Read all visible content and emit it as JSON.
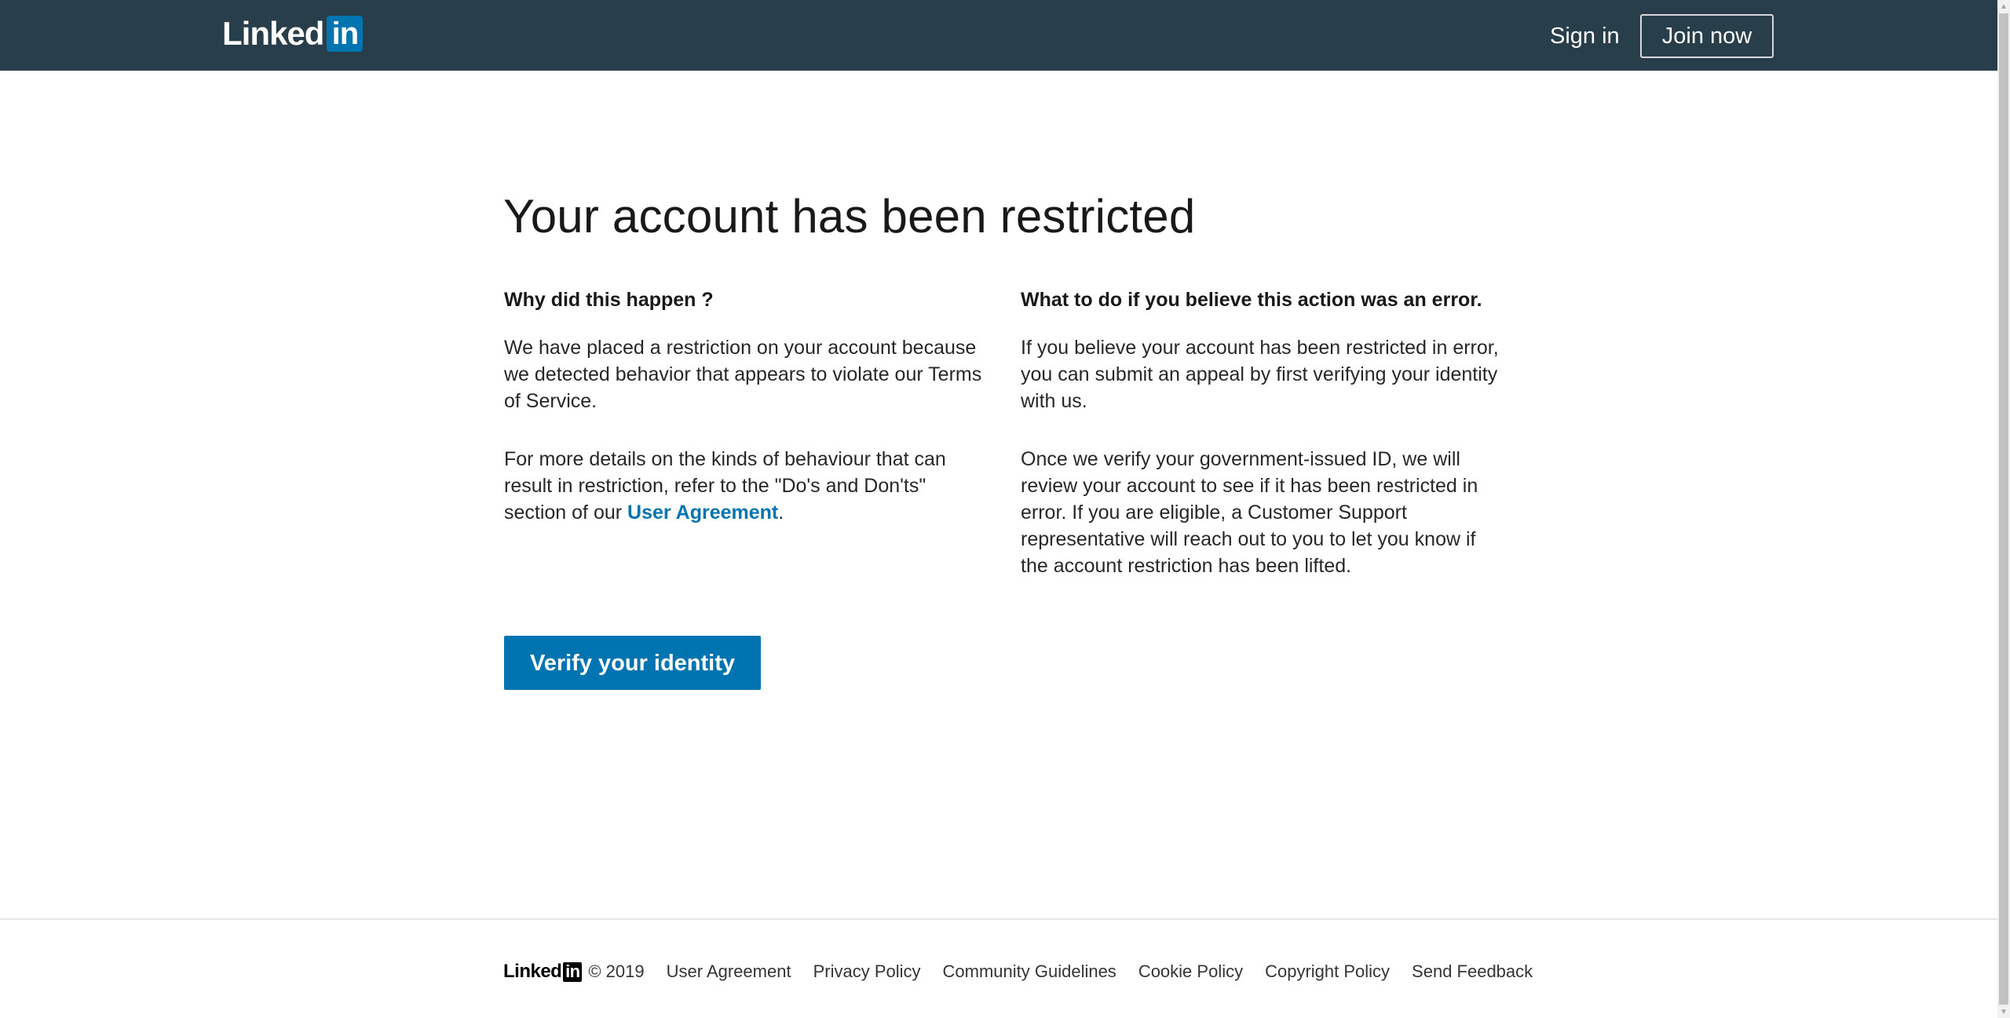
{
  "header": {
    "logo_word": "Linked",
    "logo_in": "in",
    "sign_in": "Sign in",
    "join_now": "Join now"
  },
  "main": {
    "title": "Your account has been restricted",
    "left": {
      "heading": "Why did this happen ?",
      "para1": "We have placed a restriction on your account because we detected behavior that appears to violate our Terms of Service.",
      "para2_prefix": "For more details on the kinds of behaviour that can result in restriction, refer to the \"Do's and Don'ts\" section of our ",
      "para2_link": "User Agreement",
      "para2_suffix": "."
    },
    "right": {
      "heading": "What to do if you believe this action was an error.",
      "para1": "If you believe your account has been restricted in error, you can submit an appeal by first verifying your identity with us.",
      "para2": "Once we verify your government-issued ID, we will review your account to see if it has been restricted in error. If you are eligible, a Customer Support representative will reach out to you to let you know if the account restriction has been lifted."
    },
    "verify_button": "Verify your identity"
  },
  "footer": {
    "logo_word": "Linked",
    "logo_in": "in",
    "copyright": "© 2019",
    "links": [
      "User Agreement",
      "Privacy Policy",
      "Community Guidelines",
      "Cookie Policy",
      "Copyright Policy",
      "Send Feedback"
    ]
  },
  "colors": {
    "header_bg": "#283e4a",
    "brand_blue": "#0073b1"
  },
  "icons": {
    "scroll_up": "▲",
    "scroll_down": "▼"
  }
}
